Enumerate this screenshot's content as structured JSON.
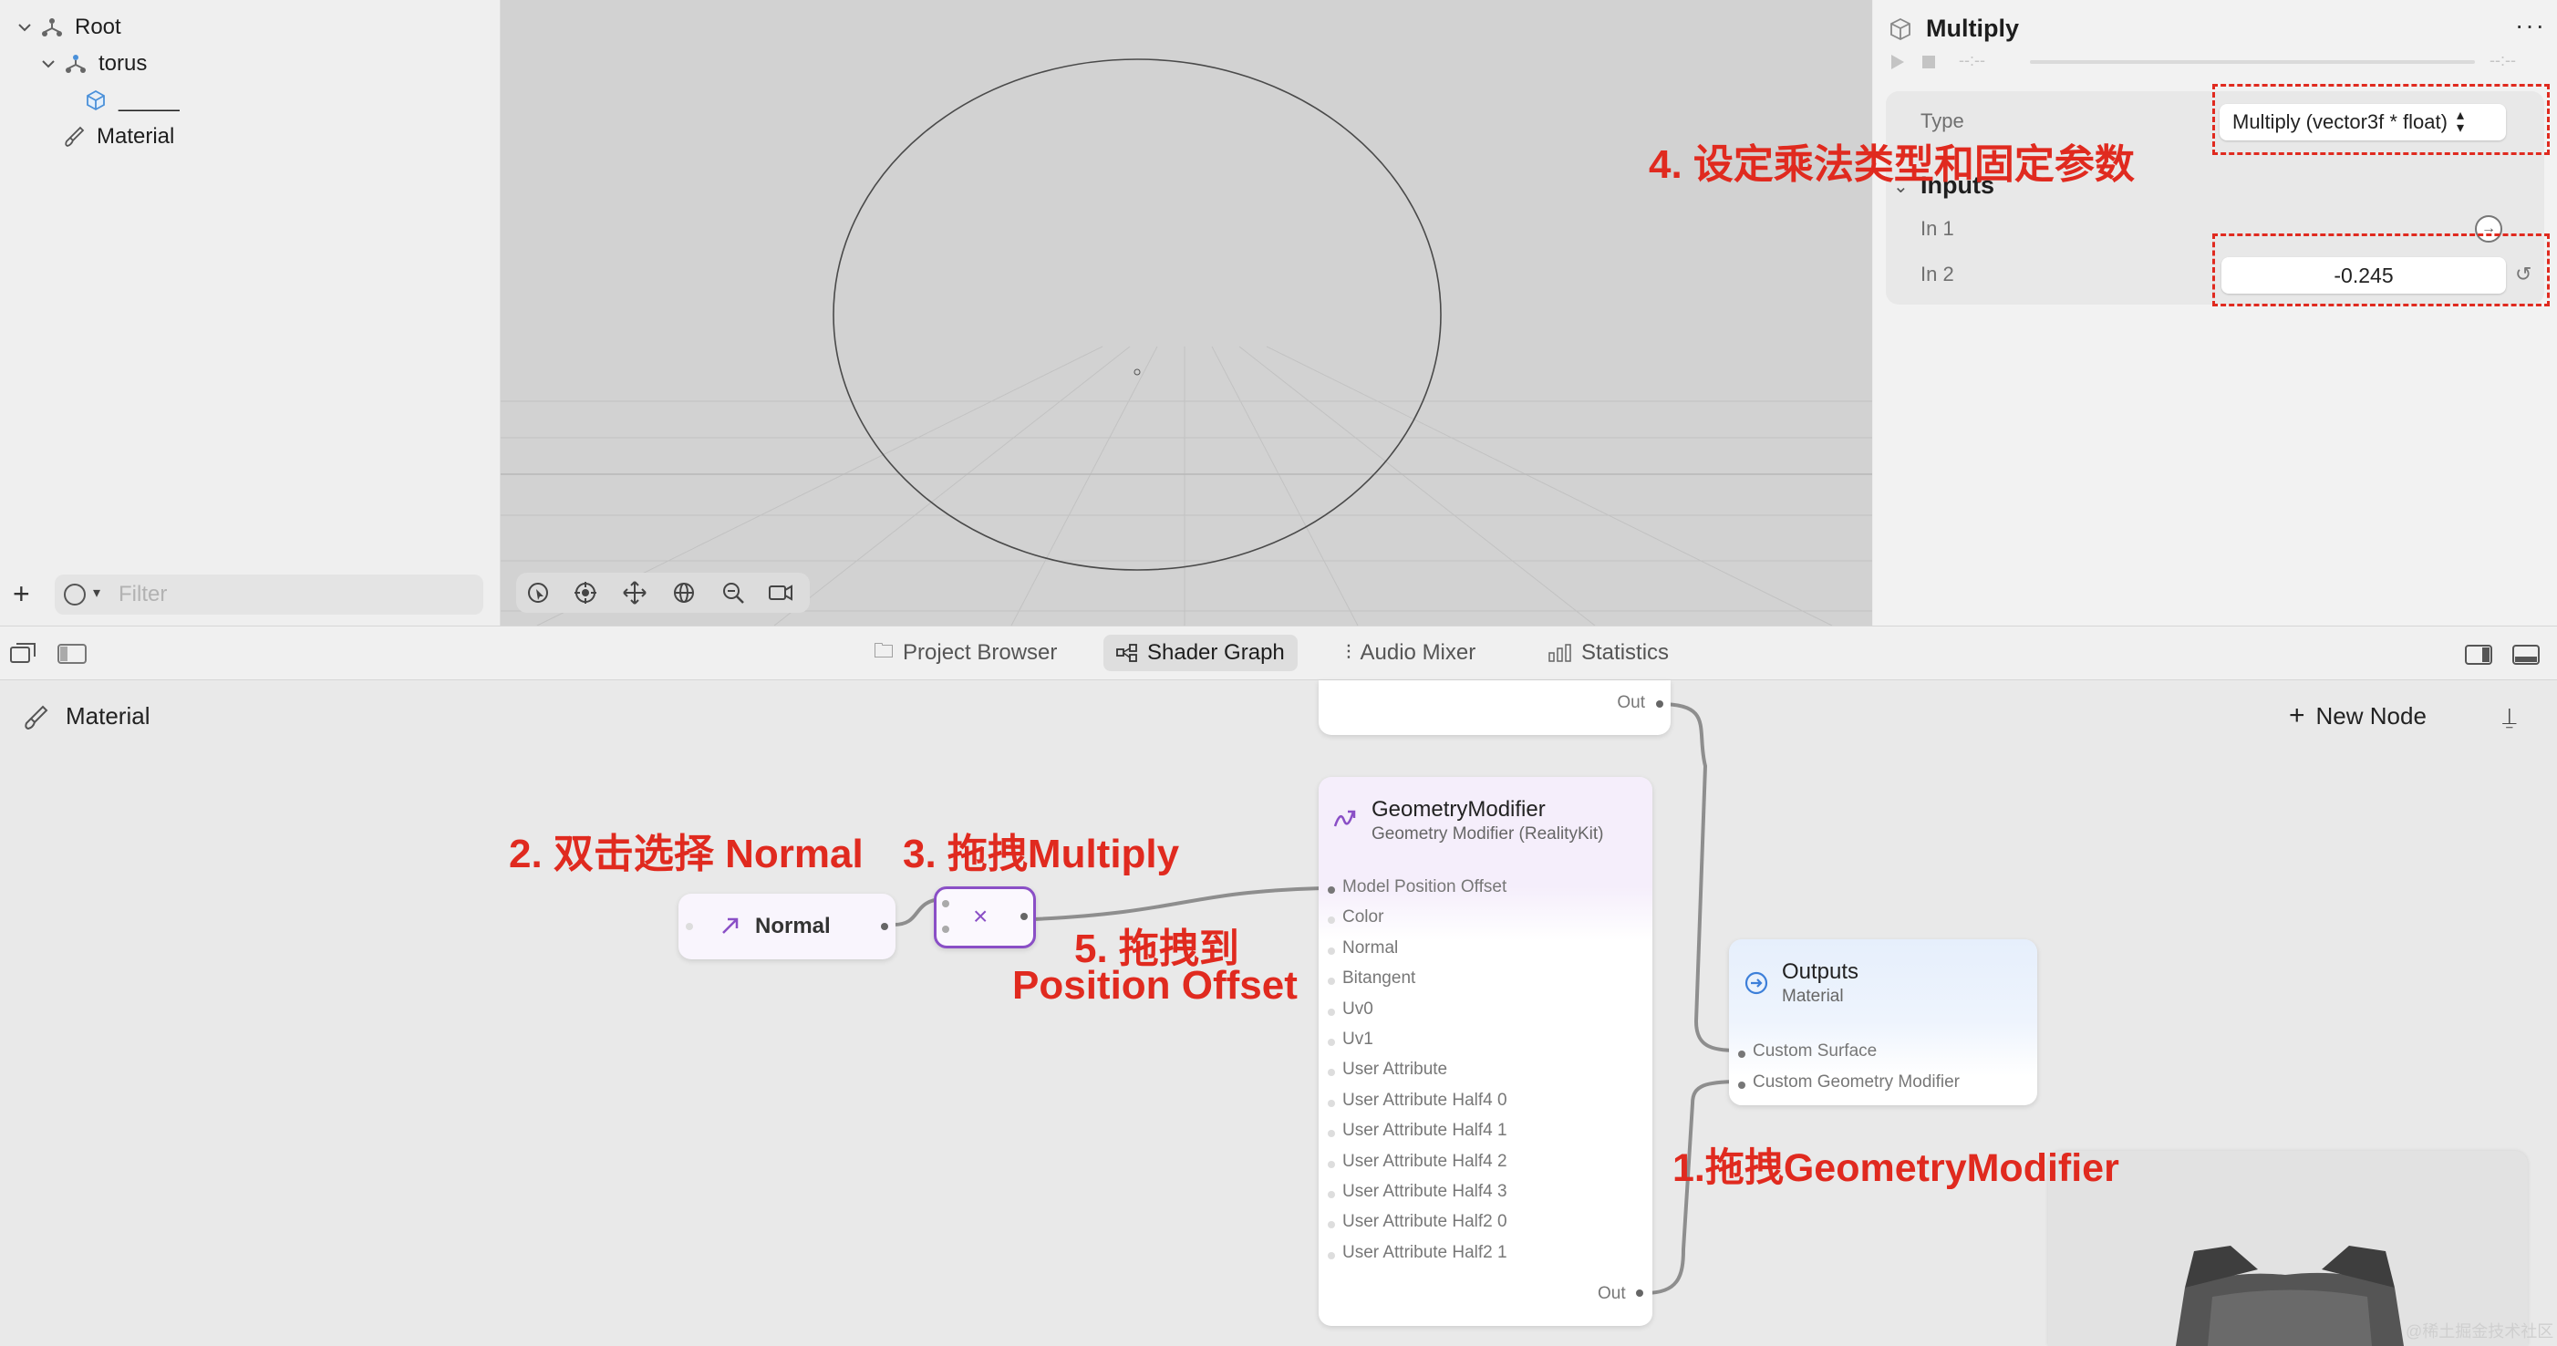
{
  "hierarchy": {
    "items": [
      {
        "label": "Root"
      },
      {
        "label": "torus"
      },
      {
        "label": "_____"
      },
      {
        "label": "Material"
      }
    ],
    "filter_placeholder": "Filter"
  },
  "inspector": {
    "title": "Multiply",
    "more": "···",
    "time_left": "--:--",
    "time_right": "--:--",
    "type_label": "Type",
    "type_value": "Multiply (vector3f * float)",
    "inputs_title": "Inputs",
    "in1_label": "In 1",
    "in2_label": "In 2",
    "in2_value": "-0.245"
  },
  "tabs": [
    {
      "label": "Project Browser",
      "icon": "folder-icon",
      "active": false
    },
    {
      "label": "Shader Graph",
      "icon": "graph-icon",
      "active": true
    },
    {
      "label": "Audio Mixer",
      "icon": "mixer-icon",
      "active": false
    },
    {
      "label": "Statistics",
      "icon": "bar-chart-icon",
      "active": false
    }
  ],
  "graph": {
    "title": "Material",
    "new_node_label": "New Node",
    "top_node_out": "Out",
    "normal_node": {
      "label": "Normal"
    },
    "multiply_node": {
      "symbol": "×"
    },
    "geometry_modifier": {
      "title": "GeometryModifier",
      "subtitle": "Geometry Modifier (RealityKit)",
      "ports": [
        "Model Position Offset",
        "Color",
        "Normal",
        "Bitangent",
        "Uv0",
        "Uv1",
        "User Attribute",
        "User Attribute Half4 0",
        "User Attribute Half4 1",
        "User Attribute Half4 2",
        "User Attribute Half4 3",
        "User Attribute Half2 0",
        "User Attribute Half2 1"
      ],
      "out": "Out"
    },
    "outputs_node": {
      "title": "Outputs",
      "subtitle": "Material",
      "ports": [
        "Custom Surface",
        "Custom Geometry Modifier"
      ]
    }
  },
  "annotations": {
    "step1": "1.拖拽GeometryModifier",
    "step2": "2. 双击选择 Normal",
    "step3": "3. 拖拽Multiply",
    "step4": "4.  设定乘法类型和固定参数",
    "step5_line1": "5. 拖拽到",
    "step5_line2": "Position Offset"
  },
  "watermark": "@稀土掘金技术社区",
  "colors": {
    "annotation_red": "#e02a1f",
    "multiply_purple": "#8a4fc6",
    "outputs_blue": "#3d7fd9"
  }
}
